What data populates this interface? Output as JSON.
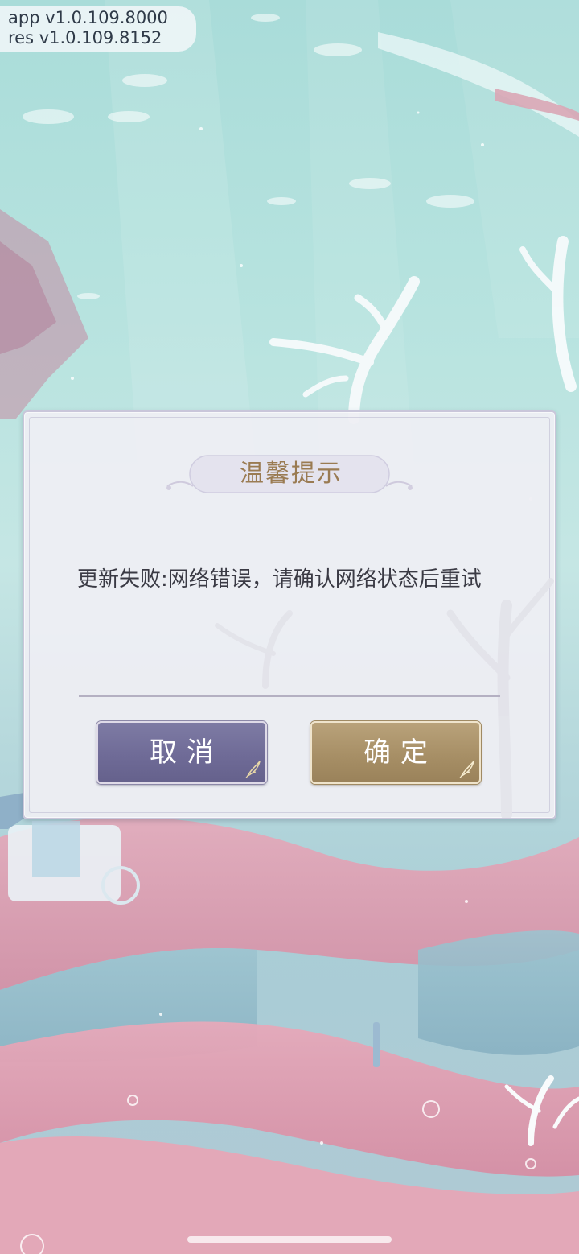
{
  "version": {
    "app": "app v1.0.109.8000",
    "res": "res v1.0.109.8152"
  },
  "dialog": {
    "title": "温馨提示",
    "message": "更新失败:网络错误，请确认网络状态后重试",
    "cancel_label": "取消",
    "confirm_label": "确定"
  },
  "colors": {
    "title_text": "#9a7b52",
    "cancel_button": "#6f6b97",
    "confirm_button": "#a78f66",
    "dialog_background": "#eeeef3"
  }
}
